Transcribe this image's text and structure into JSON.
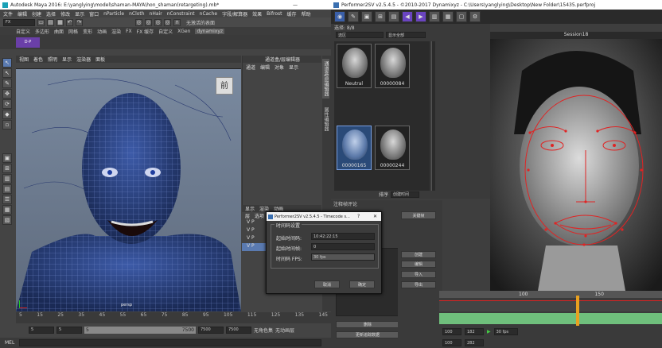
{
  "maya": {
    "title": "Autodesk Maya 2016: E:\\yanglying\\model\\shaman-MAYA\\hon_shaman(retargeting).mb*",
    "menu": [
      "文件",
      "编辑",
      "创建",
      "选择",
      "修改",
      "显示",
      "窗口",
      "nParticle",
      "nCloth",
      "nHair",
      "nConstraint",
      "nCache",
      "字段/解算器",
      "效果",
      "Bifrost",
      "缓存",
      "帮助"
    ],
    "mode": "FX",
    "no_live": "无激活的表面",
    "shelf_tabs": [
      "自定义",
      "多边形",
      "曲面",
      "网格",
      "变形",
      "动画",
      "渲染",
      "FX",
      "FX 缓存",
      "自定义",
      "XGen",
      "dynamixyz"
    ],
    "active_shelf": "dynamixyz",
    "viewport_menu": [
      "视图",
      "着色",
      "照明",
      "显示",
      "渲染器",
      "面板"
    ],
    "view_cube_label": "前",
    "persp_label": "persp",
    "channel_box_title": "通道盒/层编辑器",
    "channel_box_menu": [
      "通道",
      "编辑",
      "对象",
      "显示"
    ],
    "side_tabs": [
      "通道盒/层编辑器",
      "属性编辑器"
    ],
    "layer_tabs": [
      "显示",
      "渲染",
      "动画"
    ],
    "layer_menu": [
      "层",
      "选项",
      "帮助"
    ],
    "layer_rows": [
      "V P",
      "V P",
      "V P",
      "V P"
    ],
    "timeline_ticks": [
      "5",
      "10",
      "15",
      "20",
      "25",
      "30",
      "35",
      "40",
      "45",
      "50",
      "55",
      "60",
      "65",
      "70",
      "75",
      "80",
      "85",
      "90",
      "95",
      "100",
      "105",
      "110",
      "115",
      "120",
      "125",
      "130",
      "135",
      "140",
      "145"
    ],
    "range": {
      "start": "5",
      "current": "5",
      "bar_start": "5",
      "bar_end": "7500",
      "end": "7500",
      "end2": "7500"
    },
    "no_char": "无角色集",
    "no_anim": "无动画层",
    "mel_label": "MEL"
  },
  "performer": {
    "title": "Performer2SV v2.5.4.5 - ©2010-2017 Dynamixyz - C:\\Users\\yanglying\\Desktop\\New Folder\\15435.perfproj",
    "session_label": "Session18",
    "select_label": "选区",
    "selection_count": "选择: 8/8",
    "filter_label": "显示全部",
    "thumbs": [
      {
        "caption": "Neutral"
      },
      {
        "caption": "00000084"
      },
      {
        "caption": "00000165"
      },
      {
        "caption": "00000244"
      }
    ],
    "sort_label": "排序",
    "sort_value": "创建时间",
    "right_panel_title": "关键帧",
    "annotation_title": "注释帧评论",
    "buttons": [
      "创建",
      "编辑",
      "导入",
      "导出"
    ],
    "bottom_buttons": [
      "删除",
      "更新",
      "更新追踪数据"
    ],
    "fps_field": "30 fps",
    "frame_start": "100",
    "frame_current": "182",
    "frame_field2": "100",
    "frame_end": "282",
    "timeline_ticks": [
      "100",
      "150",
      "200"
    ],
    "tracker_label": "Performer2SV"
  },
  "dialog": {
    "title": "Performer2SV v2.5.4.5 - Timecode s...",
    "help": "?",
    "group_label": "时间码设置",
    "start_timecode_label": "起始时间码:",
    "start_timecode_value": "10:42:22:15",
    "start_frame_label": "起始时间帧:",
    "start_frame_value": "0",
    "fps_label": "时间码 FPS:",
    "fps_value": "30 fps",
    "cancel": "取消",
    "ok": "确定"
  },
  "colors": {
    "maya_blue": "#3b5da6",
    "accent_red": "#e02424",
    "dialog_bg": "#3c3c3c"
  }
}
